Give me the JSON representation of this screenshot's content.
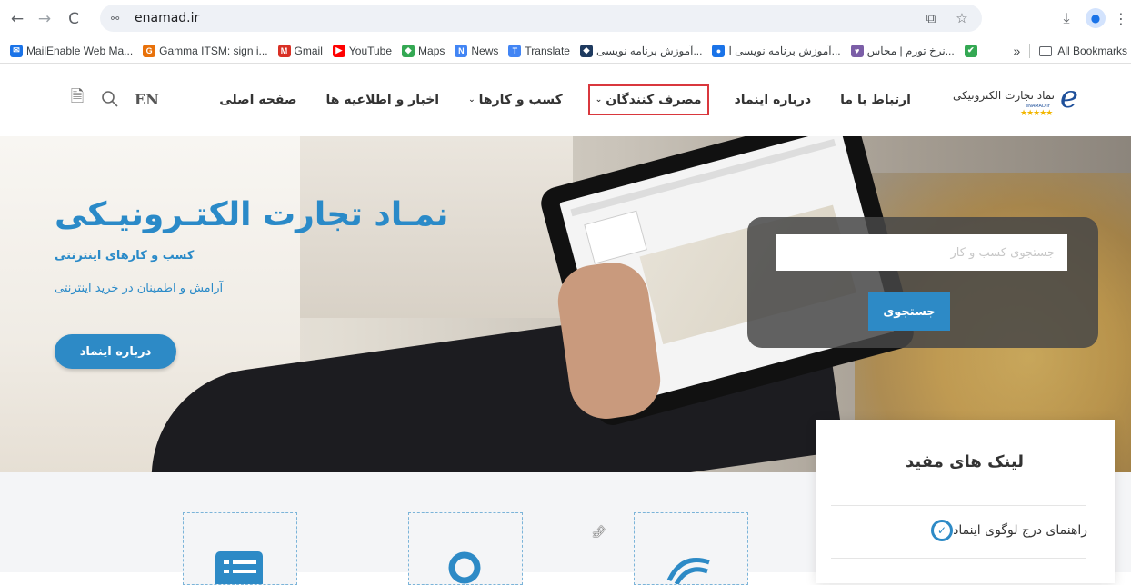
{
  "browser": {
    "url": "enamad.ir",
    "back_icon": "←",
    "forward_icon": "→",
    "reload_icon": "C",
    "site_info_icon": "⚯",
    "translate_icon": "⧉",
    "bookmark_star_icon": "☆",
    "download_icon": "⤓",
    "menu_icon": "⋮"
  },
  "bookmarks": {
    "items": [
      {
        "label": "MailEnable Web Ma...",
        "color": "#1a73e8",
        "glyph": "✉"
      },
      {
        "label": "Gamma ITSM: sign i...",
        "color": "#e8710a",
        "glyph": "G"
      },
      {
        "label": "Gmail",
        "color": "#d93025",
        "glyph": "M"
      },
      {
        "label": "YouTube",
        "color": "#ff0000",
        "glyph": "▶"
      },
      {
        "label": "Maps",
        "color": "#34a853",
        "glyph": "◆"
      },
      {
        "label": "News",
        "color": "#4285f4",
        "glyph": "N"
      },
      {
        "label": "Translate",
        "color": "#4285f4",
        "glyph": "T"
      },
      {
        "label": "آموزش برنامه نویسی...",
        "color": "#1e3a5f",
        "glyph": "◆"
      },
      {
        "label": "آموزش برنامه نویسی ا...",
        "color": "#1a73e8",
        "glyph": "●"
      },
      {
        "label": "نرخ تورم | محاس...",
        "color": "#7b5ea7",
        "glyph": "♥"
      },
      {
        "label": "",
        "color": "#34a853",
        "glyph": "✔"
      }
    ],
    "more": "»",
    "all_bookmarks": "All Bookmarks"
  },
  "header": {
    "logo_text": "نماد تجارت الکترونیکی",
    "logo_sub": "eNAMAD.ir",
    "logo_stars": "★★★★★",
    "nav": [
      {
        "label": "صفحه اصلی",
        "dropdown": false,
        "highlight": false
      },
      {
        "label": "اخبار و اطلاعیه ها",
        "dropdown": false,
        "highlight": false
      },
      {
        "label": "کسب و کارها",
        "dropdown": true,
        "highlight": false
      },
      {
        "label": "مصرف کنندگان",
        "dropdown": true,
        "highlight": true
      },
      {
        "label": "درباره اینماد",
        "dropdown": false,
        "highlight": false
      },
      {
        "label": "ارتباط با ما",
        "dropdown": false,
        "highlight": false
      }
    ],
    "lang": "EN"
  },
  "hero": {
    "title": "نمـاد تجارت الکتـرونیـکی",
    "subtitle1": "کسب و کارهای اینترنتی",
    "subtitle2": "آرامش و اطمینان در خرید اینترنتی",
    "button": "درباره اینماد",
    "search_placeholder": "جستجوی کسب و کار",
    "search_button": "جستجوی"
  },
  "useful_links": {
    "title": "لینک های مفید",
    "items": [
      {
        "label": "راهنمای درج لوگوی اینماد"
      }
    ]
  },
  "colors": {
    "accent": "#2d8ac6",
    "highlight_border": "#d9373d"
  }
}
